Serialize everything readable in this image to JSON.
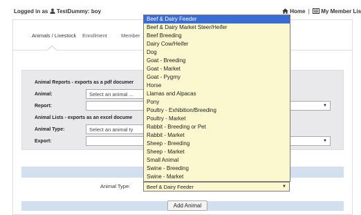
{
  "header": {
    "login_prefix": "Logged in as",
    "user_name": "TestDummy: boy",
    "home_label": "Home",
    "separator": "|",
    "member_list_label": "My Member List"
  },
  "tabs": [
    {
      "label": "Animals / Livestock",
      "active": true
    },
    {
      "label": "Enrollment",
      "active": false
    },
    {
      "label": "Member",
      "active": false
    }
  ],
  "reports": {
    "pdf_title": "Animal Reports - exports as a pdf documer",
    "animal_label": "Animal:",
    "animal_placeholder": "Select an animal ...",
    "report_label": "Report:",
    "report_value": "",
    "excel_title": "Animal Lists - exports as an excel docume",
    "animal_type_label": "Animal Type:",
    "animal_type_placeholder": "Select an animal ty",
    "export_label": "Export:",
    "export_value": ""
  },
  "add_form": {
    "animal_type_label": "Animal Type:",
    "animal_type_value": "Beef & Dairy Feeder",
    "add_button_label": "Add Animal"
  },
  "dropdown": {
    "options": [
      "Beef & Dairy Feeder",
      "Beef & Dairy Market Steer/Heifer",
      "Beef Breeding",
      "Dairy Cow/Heifer",
      "Dog",
      "Goat - Breeding",
      "Goat - Market",
      "Goat - Pygmy",
      "Horse",
      "Llamas and Alpacas",
      "Pony",
      "Poultry - Exhibition/Breeding",
      "Poultry - Market",
      "Rabbit - Breeding or Pet",
      "Rabbit - Market",
      "Sheep - Breeding",
      "Sheep - Market",
      "Small Animal",
      "Swine - Breeding",
      "Swine - Market"
    ],
    "selected_index": 0
  },
  "colors": {
    "dropdown_bg": "#fbf7cf",
    "selected_bg": "#3b6cd4",
    "blue_bar": "#d2dfee",
    "section_bg": "#e9e9ec"
  },
  "icons": [
    "user-icon",
    "home-icon",
    "list-icon",
    "dropdown-arrow-icon"
  ]
}
